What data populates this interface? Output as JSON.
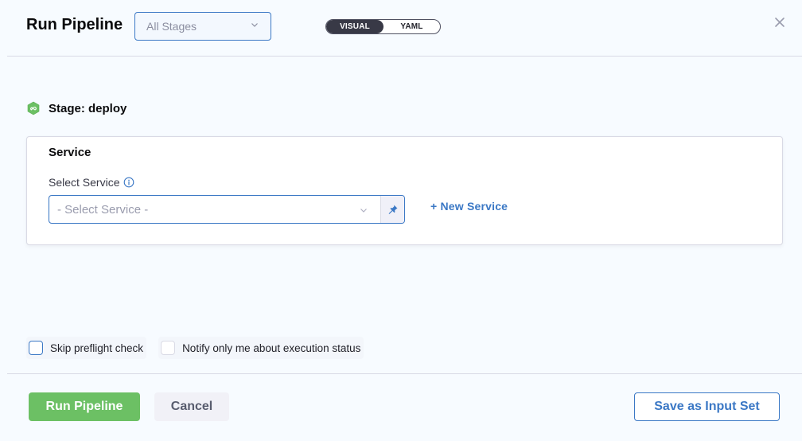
{
  "header": {
    "title": "Run Pipeline",
    "stage_filter": {
      "selected": "All Stages"
    },
    "view_toggle": {
      "options": [
        "VISUAL",
        "YAML"
      ],
      "active": "VISUAL"
    },
    "close_icon": "close-icon"
  },
  "stage": {
    "label": "Stage: deploy",
    "icon": "deploy-stage-icon"
  },
  "service_section": {
    "title": "Service",
    "field_label": "Select Service",
    "placeholder": "- Select Service -",
    "new_service_label": "+ New Service"
  },
  "options": {
    "skip_preflight": {
      "label": "Skip preflight check",
      "checked": false
    },
    "notify_only_me": {
      "label": "Notify only me about execution status",
      "checked": false
    }
  },
  "footer": {
    "run_label": "Run Pipeline",
    "cancel_label": "Cancel",
    "save_input_set_label": "Save as Input Set"
  },
  "colors": {
    "primary": "#3b78c5",
    "run_button": "#6cc064",
    "toggle_active": "#383946"
  }
}
